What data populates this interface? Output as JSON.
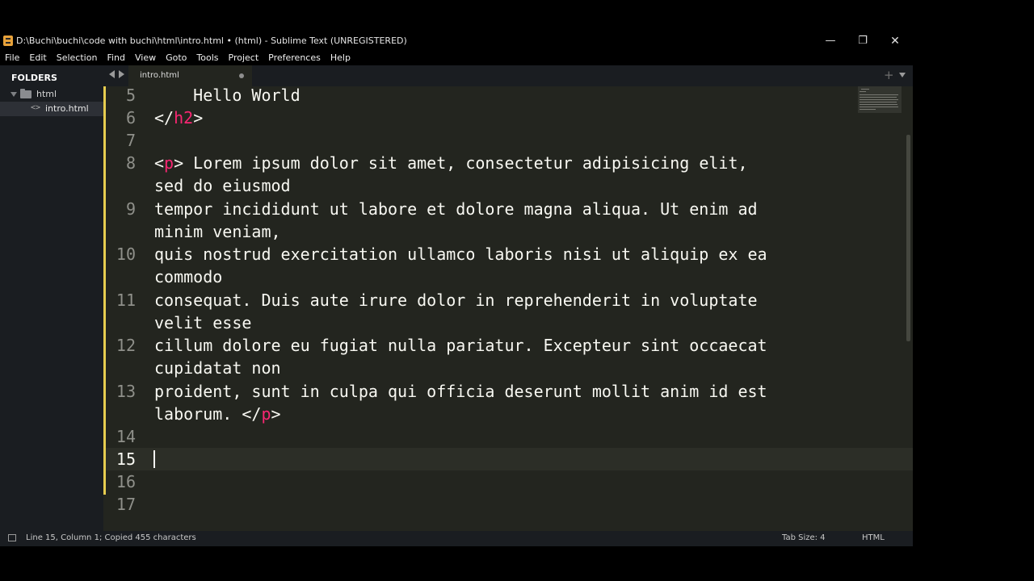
{
  "window": {
    "title": "D:\\Buchi\\buchi\\code with buchi\\html\\intro.html • (html) - Sublime Text (UNREGISTERED)",
    "controls": {
      "minimize": "—",
      "maximize": "❐",
      "close": "✕"
    }
  },
  "menu": {
    "items": [
      "File",
      "Edit",
      "Selection",
      "Find",
      "View",
      "Goto",
      "Tools",
      "Project",
      "Preferences",
      "Help"
    ]
  },
  "sidebar": {
    "header": "FOLDERS",
    "folder": "html",
    "file": "intro.html",
    "file_icon": "<>"
  },
  "tabs": {
    "active": "intro.html",
    "plus": "+"
  },
  "editor": {
    "line_numbers": [
      "5",
      "6",
      "7",
      "8",
      "9",
      "10",
      "11",
      "12",
      "13",
      "14",
      "15",
      "16",
      "17"
    ],
    "current_line": "15",
    "line5": "    Hello World",
    "line6_open": "</",
    "line6_tag": "h2",
    "line6_close": ">",
    "line8_open": "<",
    "line8_tag": "p",
    "line8_close": ">",
    "line8_text": " Lorem ipsum dolor sit amet, consectetur adipisicing elit,",
    "line8_wrap": "sed do eiusmod",
    "line9_a": "tempor incididunt ut labore et dolore magna aliqua. Ut enim ad",
    "line9_b": "minim veniam,",
    "line10_a": "quis nostrud exercitation ullamco laboris nisi ut aliquip ex ea",
    "line10_b": "commodo",
    "line11_a": "consequat. Duis aute irure dolor in reprehenderit in voluptate",
    "line11_b": "velit esse",
    "line12_a": "cillum dolore eu fugiat nulla pariatur. Excepteur sint occaecat",
    "line12_b": "cupidatat non",
    "line13_a": "proident, sunt in culpa qui officia deserunt mollit anim id est",
    "line13_b_text": "laborum. ",
    "line13_b_open": "</",
    "line13_b_tag": "p",
    "line13_b_close": ">"
  },
  "status": {
    "text": "Line 15, Column 1; Copied 455 characters",
    "tab_size": "Tab Size: 4",
    "syntax": "HTML"
  },
  "colors": {
    "tag": "#f92672",
    "text": "#f8f8f2",
    "gutter_mark": "#e6cc4f",
    "editor_bg": "#23251f",
    "sidebar_bg": "#1a1d21"
  }
}
